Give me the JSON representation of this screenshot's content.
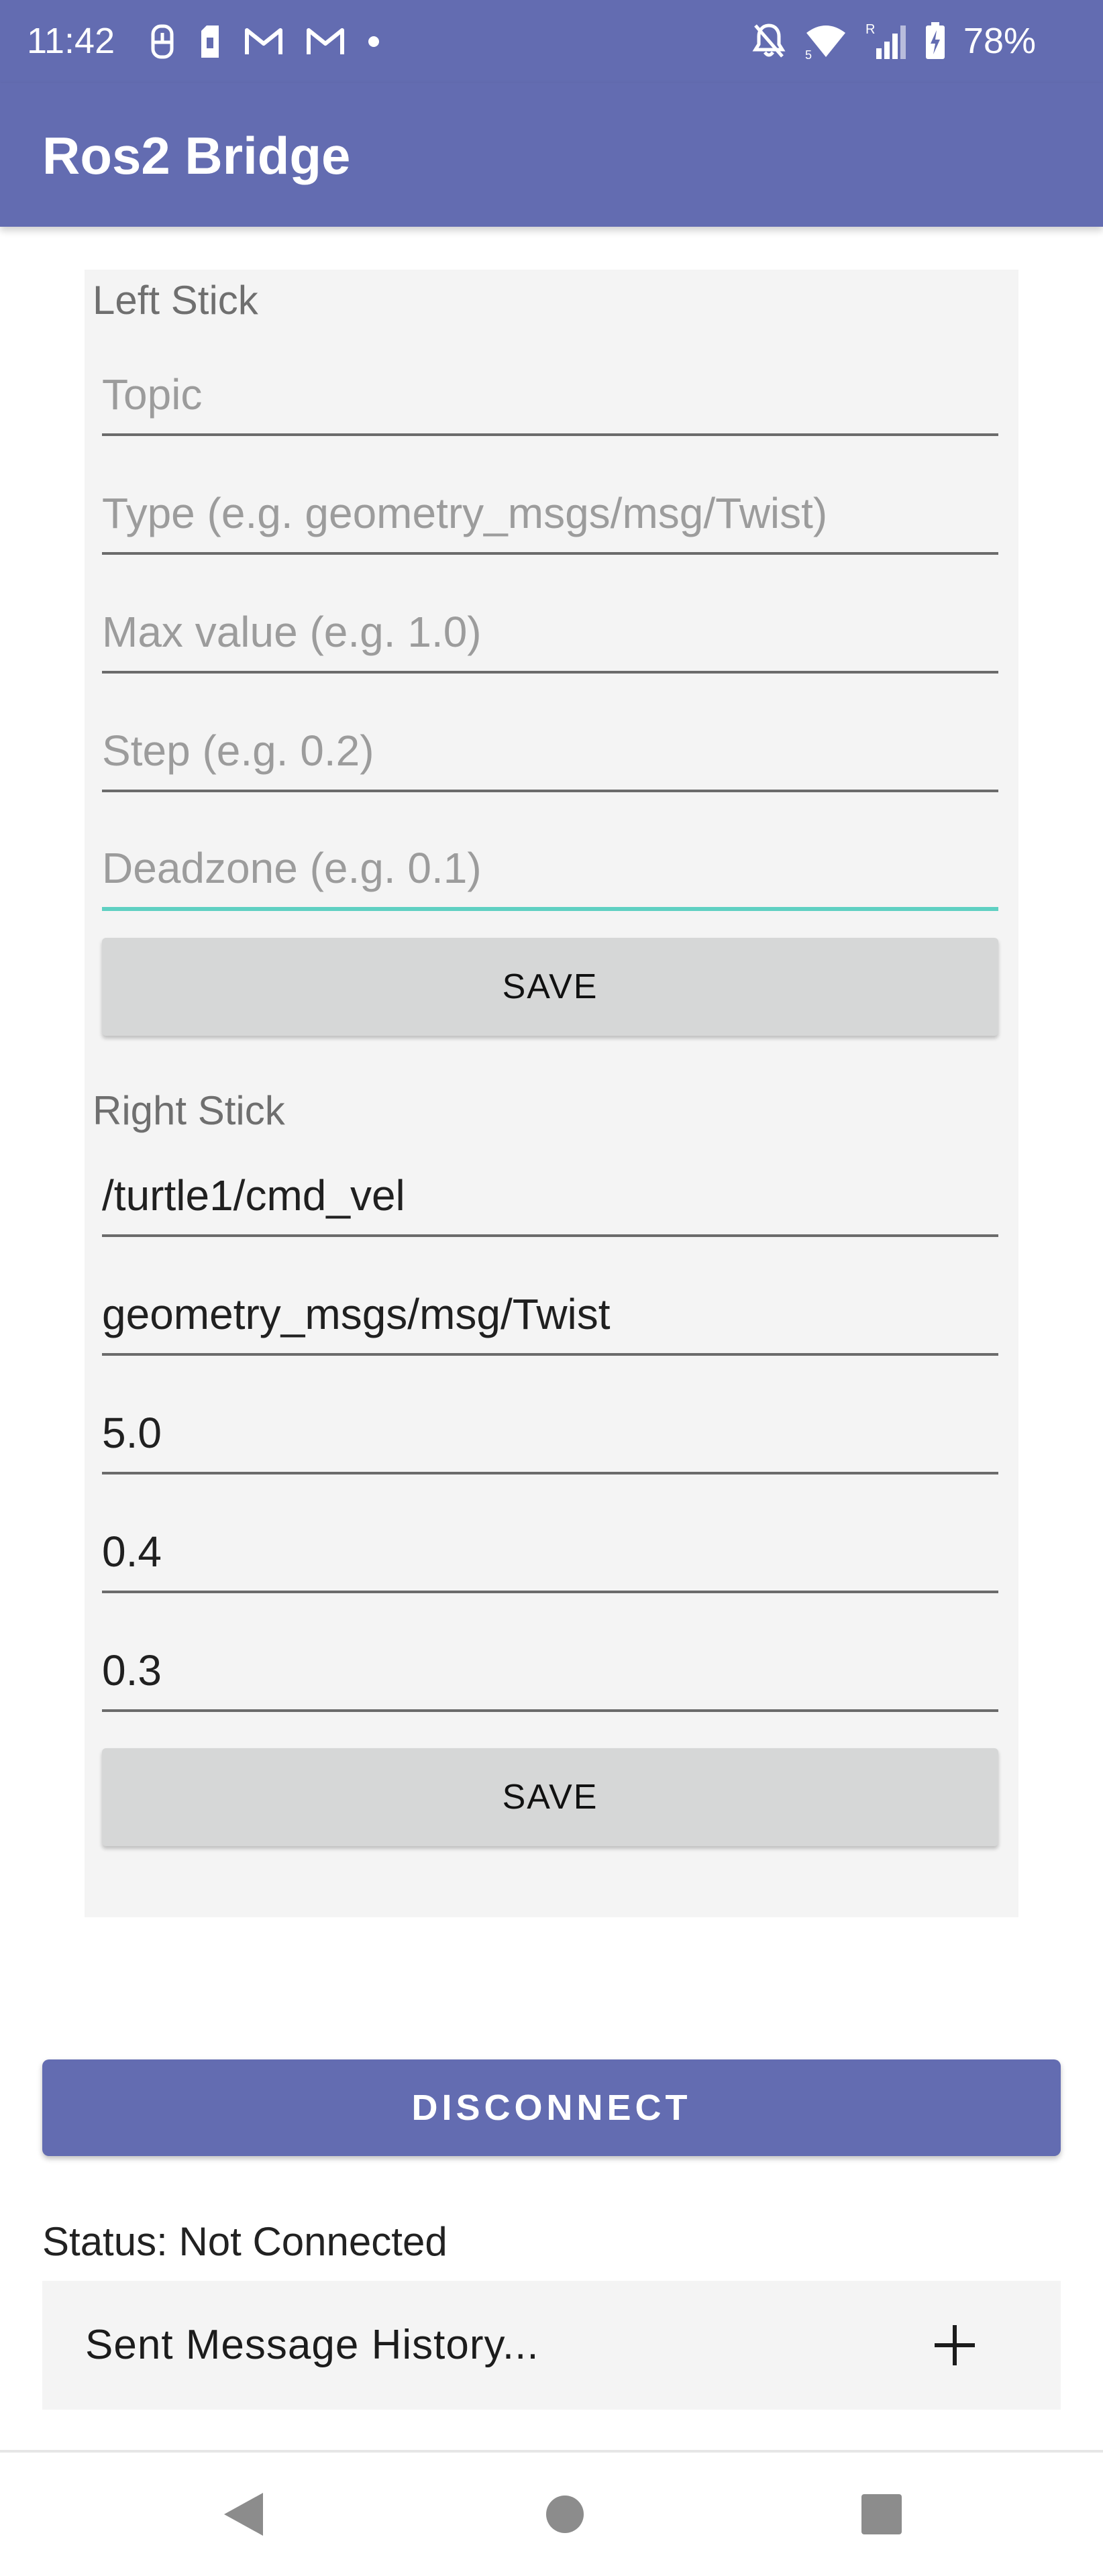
{
  "status_bar": {
    "time": "11:42",
    "battery_percent": "78%",
    "icons_left": [
      "usb-icon",
      "sim-icon",
      "gmail-icon",
      "gmail-icon",
      "notification-dot-icon"
    ],
    "icons_right": [
      "notifications-off-icon",
      "wifi-icon",
      "cell-signal-icon",
      "battery-charging-icon"
    ],
    "wifi_badge": "5",
    "roaming_badge": "R"
  },
  "app_bar": {
    "title": "Ros2 Bridge"
  },
  "left_stick": {
    "label": "Left Stick",
    "fields": [
      {
        "value": "",
        "placeholder": "Topic"
      },
      {
        "value": "",
        "placeholder": "Type (e.g. geometry_msgs/msg/Twist)"
      },
      {
        "value": "",
        "placeholder": "Max value (e.g. 1.0)"
      },
      {
        "value": "",
        "placeholder": "Step (e.g. 0.2)"
      },
      {
        "value": "",
        "placeholder": "Deadzone (e.g. 0.1)",
        "focused": true
      }
    ],
    "save_label": "SAVE"
  },
  "right_stick": {
    "label": "Right Stick",
    "fields": [
      {
        "value": "/turtle1/cmd_vel"
      },
      {
        "value": "geometry_msgs/msg/Twist"
      },
      {
        "value": "5.0"
      },
      {
        "value": "0.4"
      },
      {
        "value": "0.3"
      }
    ],
    "save_label": "SAVE"
  },
  "connection": {
    "button_label": "DISCONNECT",
    "status_text": "Status: Not Connected"
  },
  "history": {
    "label": "Sent Message History...",
    "expand_icon": "plus-icon"
  },
  "nav_bar": {
    "buttons": [
      "back-icon",
      "home-icon",
      "recents-icon"
    ]
  },
  "colors": {
    "primary": "#636cb1",
    "focus_underline": "#5fd0c2",
    "panel_background": "#f4f4f4",
    "save_button": "#d6d7d7"
  }
}
